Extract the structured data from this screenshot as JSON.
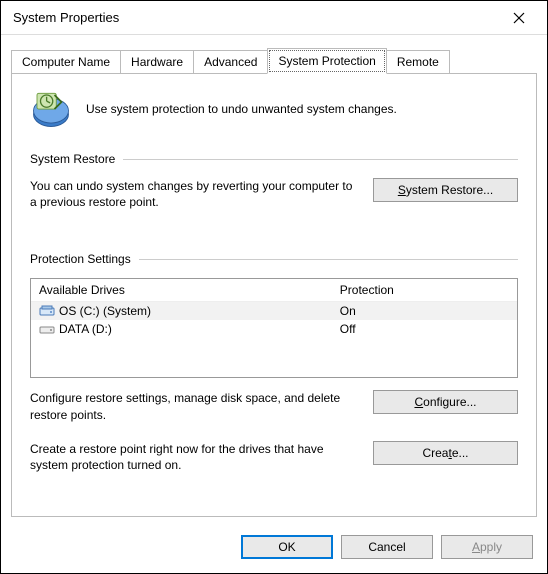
{
  "window": {
    "title": "System Properties"
  },
  "tabs": {
    "computer_name": "Computer Name",
    "hardware": "Hardware",
    "advanced": "Advanced",
    "system_protection": "System Protection",
    "remote": "Remote"
  },
  "intro": {
    "text": "Use system protection to undo unwanted system changes."
  },
  "sections": {
    "system_restore": {
      "header": "System Restore",
      "desc": "You can undo system changes by reverting your computer to a previous restore point.",
      "button": "System Restore..."
    },
    "protection_settings": {
      "header": "Protection Settings",
      "col_drives": "Available Drives",
      "col_protection": "Protection",
      "drives": [
        {
          "label": "OS (C:) (System)",
          "protection": "On"
        },
        {
          "label": "DATA (D:)",
          "protection": "Off"
        }
      ],
      "configure_desc": "Configure restore settings, manage disk space, and delete restore points.",
      "configure_btn": "Configure...",
      "create_desc": "Create a restore point right now for the drives that have system protection turned on.",
      "create_btn": "Create..."
    }
  },
  "footer": {
    "ok": "OK",
    "cancel": "Cancel",
    "apply": "Apply"
  }
}
